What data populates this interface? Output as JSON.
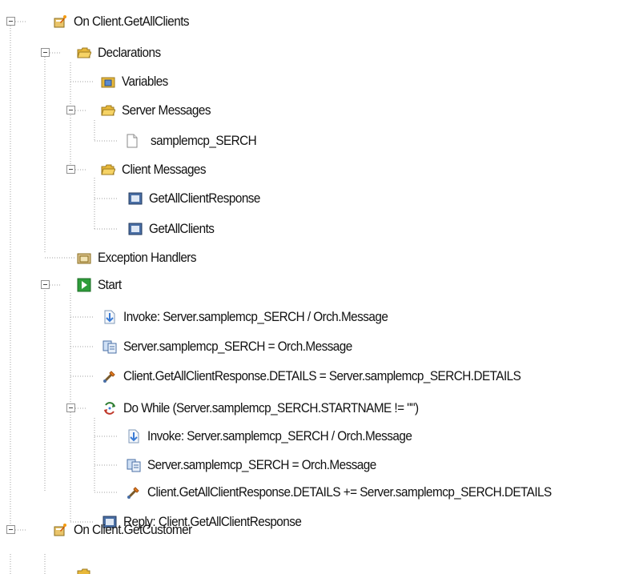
{
  "tree": {
    "nodes": [
      {
        "id": "on-client-getallclients",
        "icon": "operation-icon",
        "label": "On Client.GetAllClients",
        "expanded": true
      },
      {
        "id": "declarations",
        "icon": "folder-open-icon",
        "label": "Declarations",
        "expanded": true
      },
      {
        "id": "variables",
        "icon": "variables-folder-icon",
        "label": "Variables"
      },
      {
        "id": "server-messages",
        "icon": "folder-open-icon",
        "label": "Server Messages",
        "expanded": true
      },
      {
        "id": "samplemcp-serch-message",
        "icon": "document-icon",
        "label": "samplemcp_SERCH"
      },
      {
        "id": "client-messages",
        "icon": "folder-open-icon",
        "label": "Client Messages",
        "expanded": true
      },
      {
        "id": "getallclientresponse",
        "icon": "message-icon",
        "label": "GetAllClientResponse"
      },
      {
        "id": "getallclients",
        "icon": "message-icon",
        "label": "GetAllClients"
      },
      {
        "id": "exception-handlers",
        "icon": "exception-folder-icon",
        "label": "Exception Handlers"
      },
      {
        "id": "start",
        "icon": "start-icon",
        "label": "Start",
        "expanded": true
      },
      {
        "id": "invoke-1",
        "icon": "invoke-icon",
        "label": "Invoke: Server.samplemcp_SERCH / Orch.Message"
      },
      {
        "id": "assign-1",
        "icon": "assign-icon",
        "label": "Server.samplemcp_SERCH = Orch.Message"
      },
      {
        "id": "transform-1",
        "icon": "transform-icon",
        "label": "Client.GetAllClientResponse.DETAILS = Server.samplemcp_SERCH.DETAILS"
      },
      {
        "id": "do-while",
        "icon": "loop-icon",
        "label": "Do While (Server.samplemcp_SERCH.STARTNAME != \"\")",
        "expanded": true
      },
      {
        "id": "invoke-2",
        "icon": "invoke-icon",
        "label": "Invoke: Server.samplemcp_SERCH / Orch.Message"
      },
      {
        "id": "assign-2",
        "icon": "assign-icon",
        "label": "Server.samplemcp_SERCH = Orch.Message"
      },
      {
        "id": "transform-2",
        "icon": "transform-icon",
        "label": "Client.GetAllClientResponse.DETAILS += Server.samplemcp_SERCH.DETAILS"
      },
      {
        "id": "reply",
        "icon": "message-icon",
        "label": "Reply: Client.GetAllClientResponse"
      },
      {
        "id": "on-client-getcustomer",
        "icon": "operation-icon",
        "label": "On Client.GetCustomer",
        "expanded": true
      }
    ]
  },
  "colors": {
    "tree_line": "#a0a0a0",
    "folder": "#f2c94c",
    "message_icon": "#4a6fa5",
    "start_icon": "#2e9d3a"
  }
}
